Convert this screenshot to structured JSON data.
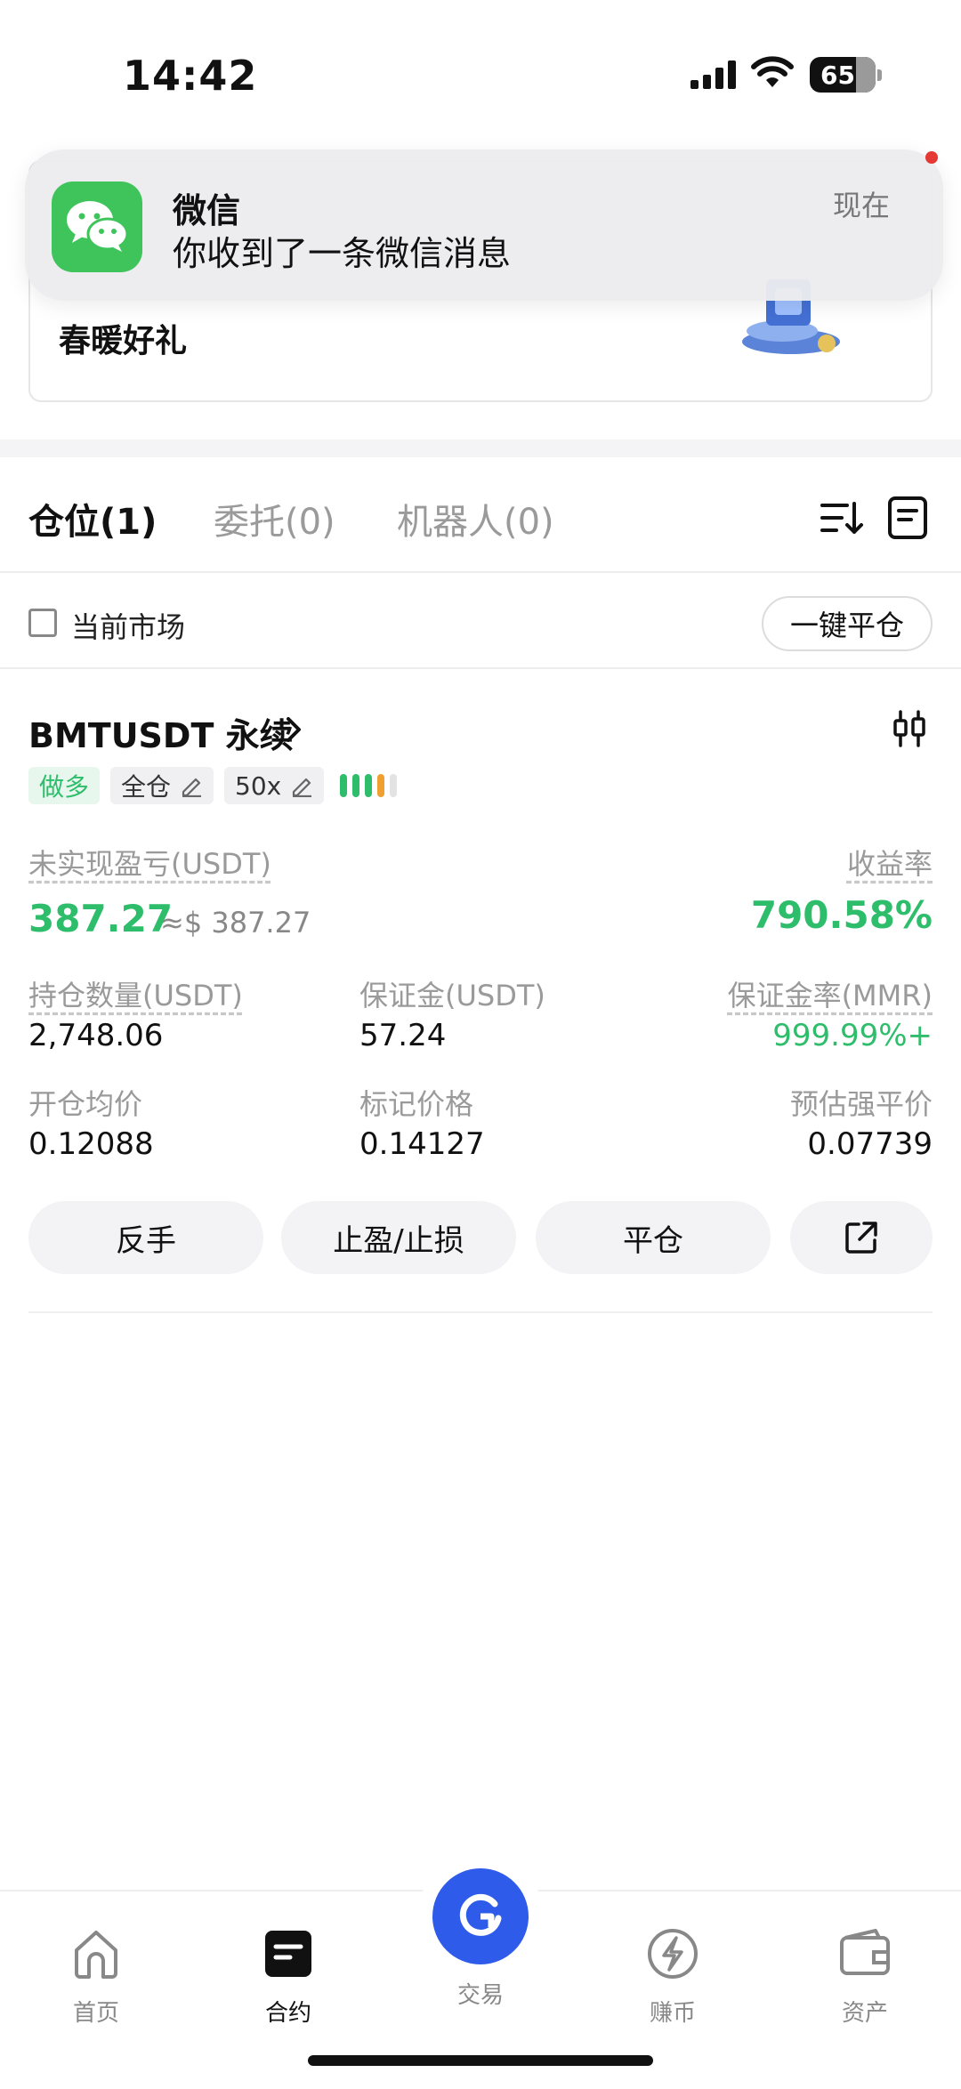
{
  "status_bar": {
    "time": "14:42",
    "battery": "65"
  },
  "notification": {
    "app": "微信",
    "message": "你收到了一条微信消息",
    "time": "现在"
  },
  "promo": {
    "title": "春暖好礼"
  },
  "tabs": [
    {
      "label": "仓位(1)",
      "active": true
    },
    {
      "label": "委托(0)",
      "active": false
    },
    {
      "label": "机器人(0)",
      "active": false
    }
  ],
  "filter": {
    "current_market_label": "当前市场",
    "close_all_label": "一键平仓"
  },
  "position": {
    "symbol": "BMTUSDT 永续",
    "tags": {
      "side": "做多",
      "margin_mode": "全仓",
      "leverage": "50x"
    },
    "unrealized_pnl_label": "未实现盈亏(USDT)",
    "unrealized_pnl": "387.27",
    "unrealized_pnl_usd": "≈$ 387.27",
    "roe_label": "收益率",
    "roe": "790.58%",
    "size_label": "持仓数量(USDT)",
    "size": "2,748.06",
    "margin_label": "保证金(USDT)",
    "margin": "57.24",
    "mmr_label": "保证金率(MMR)",
    "mmr": "999.99%+",
    "entry_label": "开仓均价",
    "entry": "0.12088",
    "mark_label": "标记价格",
    "mark": "0.14127",
    "liq_label": "预估强平价",
    "liq": "0.07739"
  },
  "actions": {
    "reverse": "反手",
    "tpsl": "止盈/止损",
    "close": "平仓"
  },
  "bottom_nav": {
    "home": "首页",
    "futures": "合约",
    "trade": "交易",
    "earn": "赚币",
    "assets": "资产"
  },
  "colors": {
    "green": "#2ebd6b",
    "primary": "#2f5bea"
  }
}
